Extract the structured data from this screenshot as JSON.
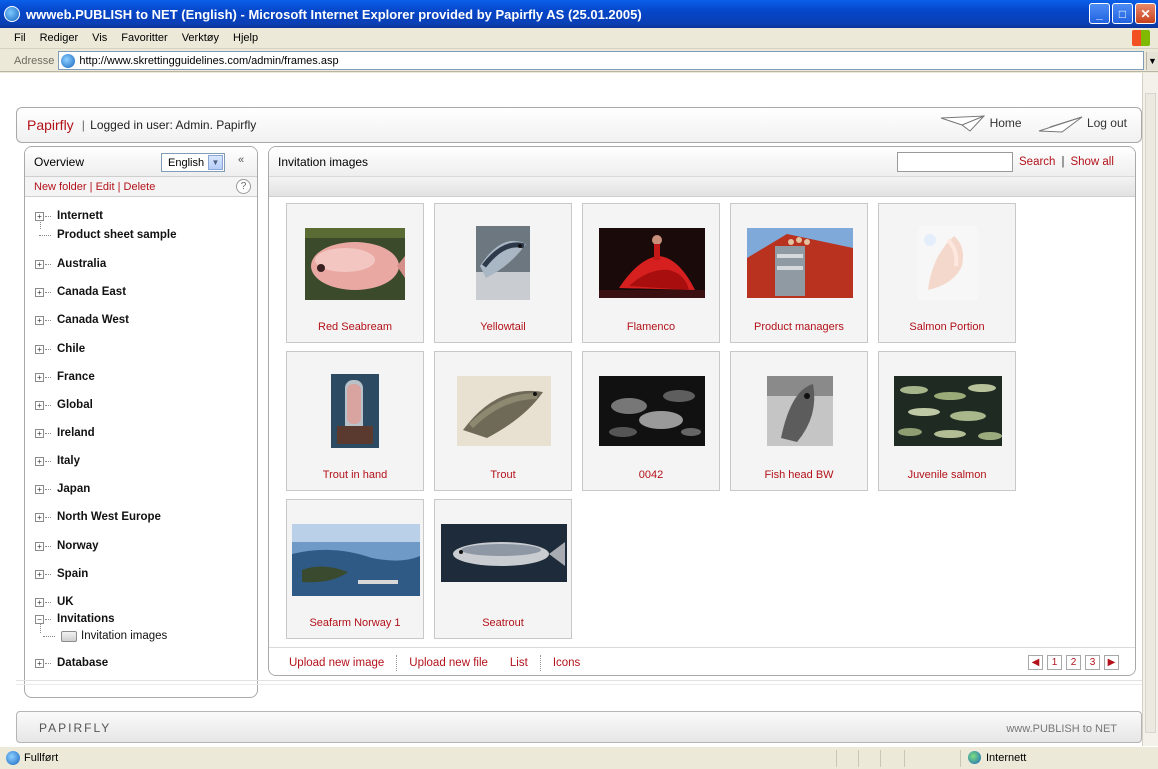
{
  "window": {
    "title": "wwweb.PUBLISH to NET (English) - Microsoft Internet Explorer provided by Papirfly AS (25.01.2005)"
  },
  "menu": {
    "items": [
      "Fil",
      "Rediger",
      "Vis",
      "Favoritter",
      "Verktøy",
      "Hjelp"
    ]
  },
  "address": {
    "label": "Adresse",
    "url": "http://www.skrettingguidelines.com/admin/frames.asp"
  },
  "header": {
    "brand": "Papirfly",
    "separator": "|",
    "login_text": "Logged in user: Admin.  Papirfly",
    "home": "Home",
    "logout": "Log out"
  },
  "left": {
    "title": "Overview",
    "language": "English",
    "collapse": "«",
    "actions": {
      "new_folder": "New folder",
      "edit": "Edit",
      "delete": "Delete",
      "sep": "|"
    },
    "help": "?",
    "tree": [
      "Internett",
      "Product sheet sample",
      "Australia",
      "Canada East",
      "Canada West",
      "Chile",
      "France",
      "Global",
      "Ireland",
      "Italy",
      "Japan",
      "North West Europe",
      "Norway",
      "Spain",
      "UK",
      "Invitations",
      "Invitation images",
      "Database"
    ]
  },
  "main": {
    "title": "Invitation images",
    "search_label": "Search",
    "bar": "|",
    "show_all": "Show all",
    "images": [
      "Red Seabream",
      "Yellowtail",
      "Flamenco",
      "Product managers",
      "Salmon Portion",
      "Trout in hand",
      "Trout",
      "0042",
      "Fish head BW",
      "Juvenile salmon",
      "Seafarm Norway 1",
      "Seatrout"
    ],
    "footer": {
      "upload_image": "Upload new image",
      "upload_file": "Upload new file",
      "list": "List",
      "icons": "Icons"
    },
    "pager": [
      "1",
      "2",
      "3"
    ]
  },
  "bottom": {
    "logo": "PAPIRFLY",
    "tagline": "www.PUBLISH to NET"
  },
  "status": {
    "text": "Fullført",
    "zone": "Internett"
  }
}
